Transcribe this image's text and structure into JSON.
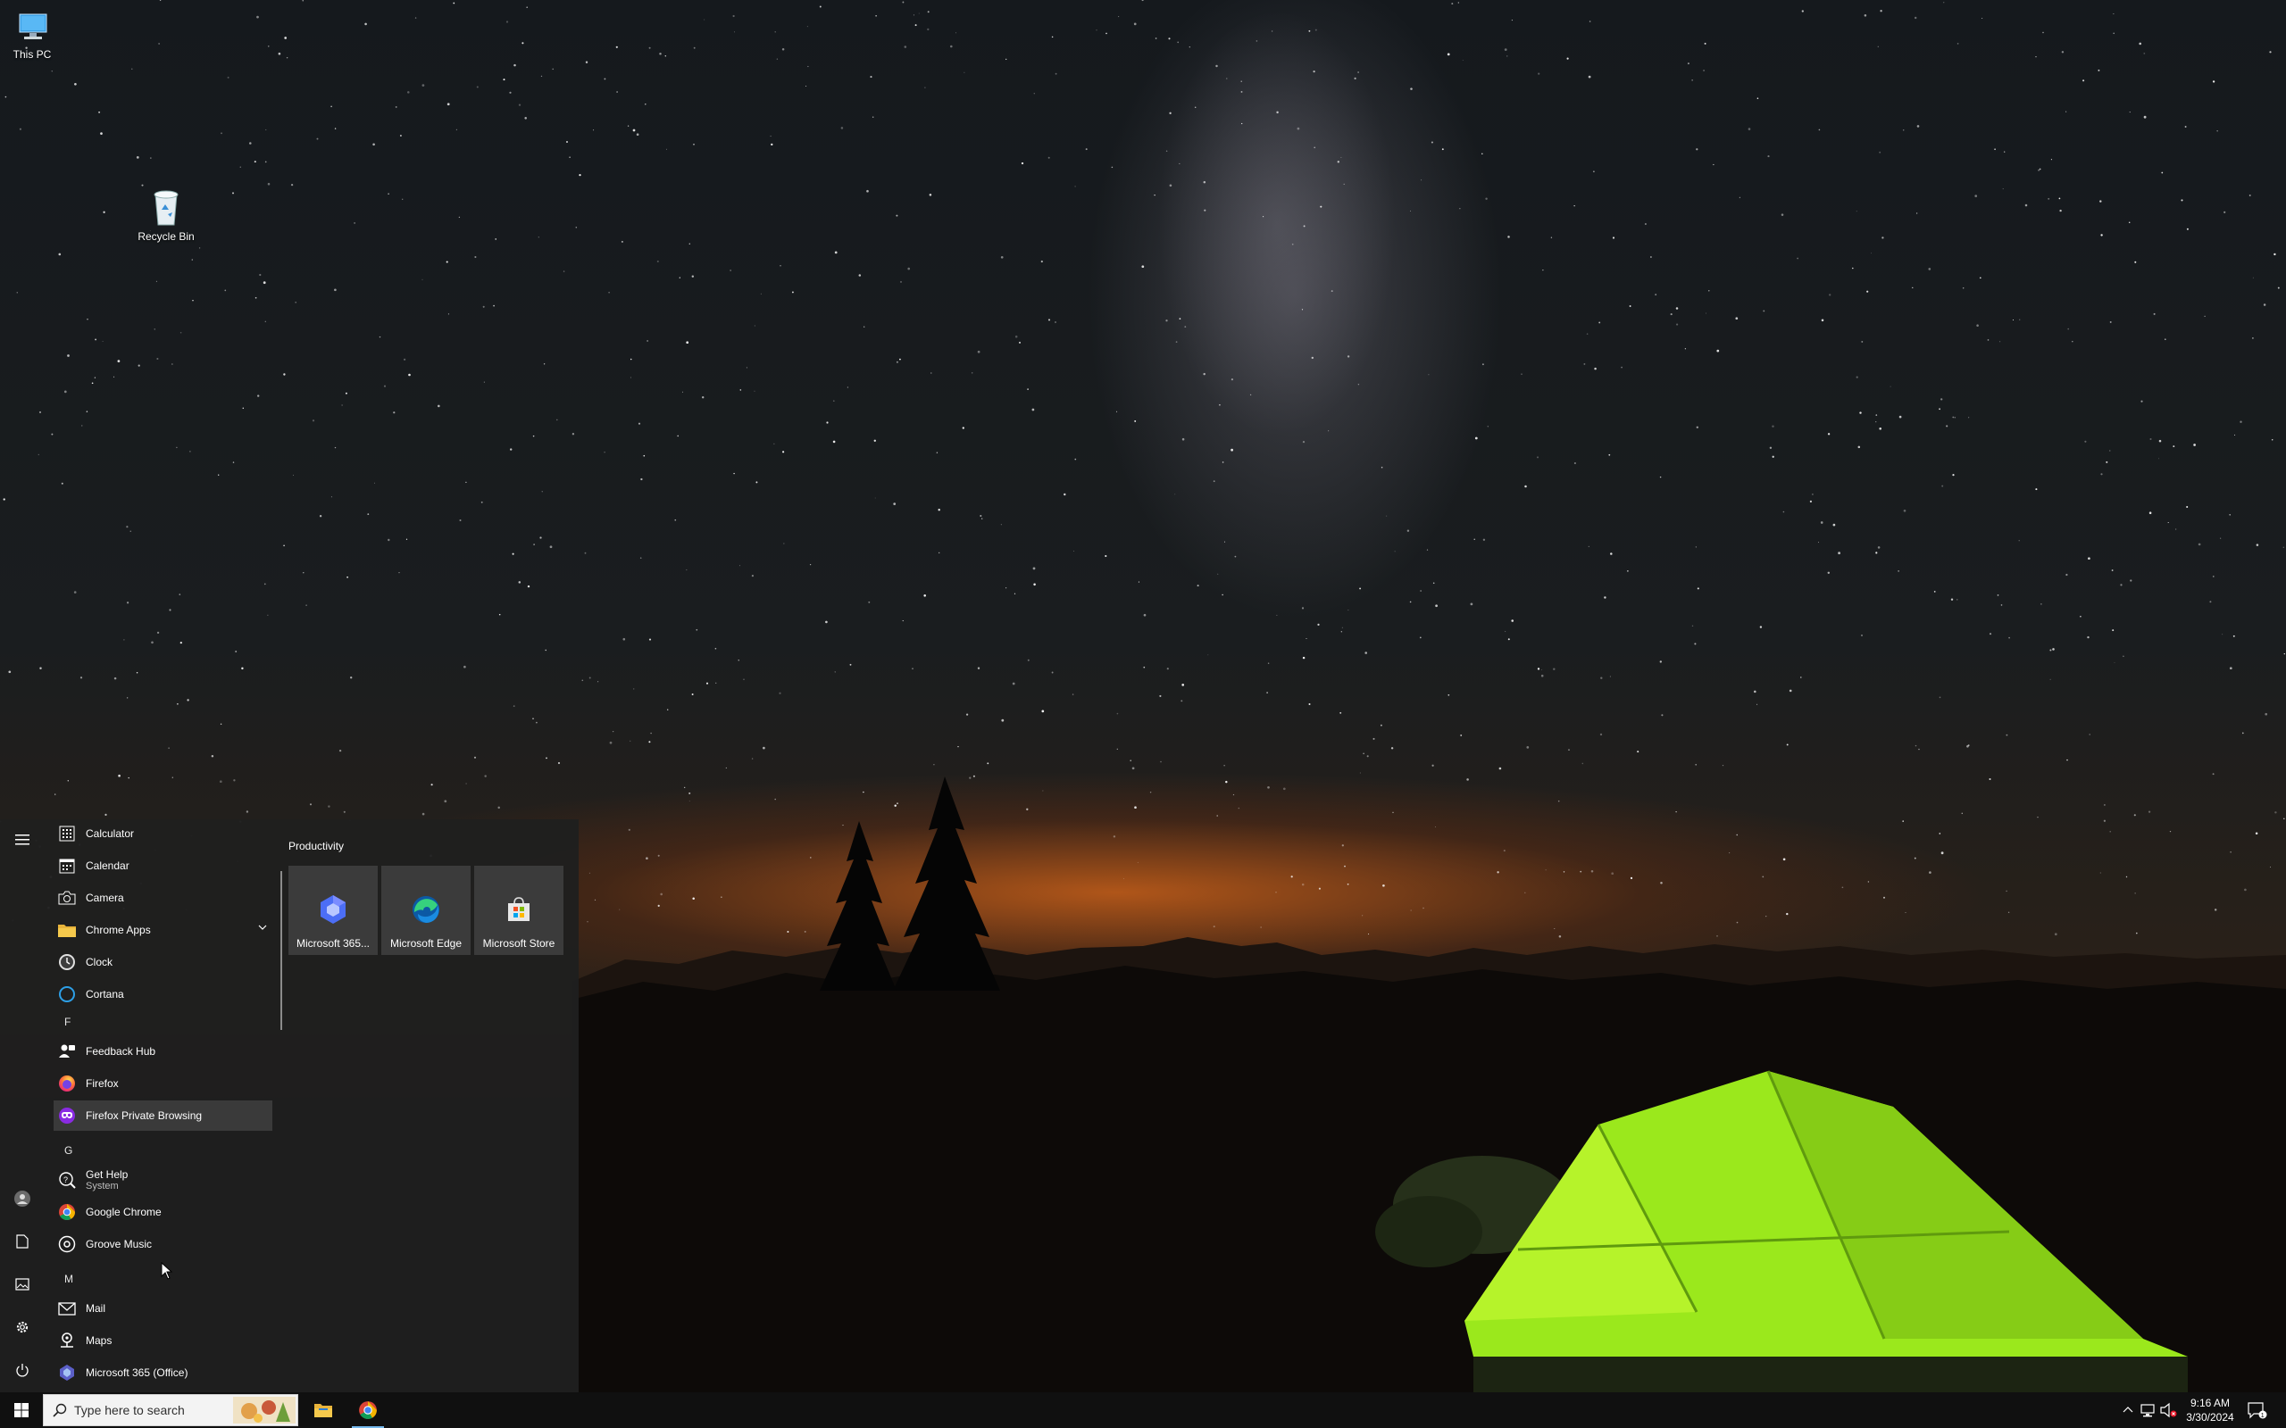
{
  "desktop": {
    "icons": [
      {
        "label": "This PC"
      },
      {
        "label": "Recycle Bin"
      }
    ]
  },
  "start_menu": {
    "apps": [
      {
        "label": "Calculator"
      },
      {
        "label": "Calendar"
      },
      {
        "label": "Camera"
      },
      {
        "label": "Chrome Apps"
      },
      {
        "label": "Clock"
      },
      {
        "label": "Cortana"
      },
      {
        "label": "Feedback Hub"
      },
      {
        "label": "Firefox"
      },
      {
        "label": "Firefox Private Browsing"
      },
      {
        "label": "Get Help",
        "sublabel": "System"
      },
      {
        "label": "Google Chrome"
      },
      {
        "label": "Groove Music"
      },
      {
        "label": "Mail"
      },
      {
        "label": "Maps"
      },
      {
        "label": "Microsoft 365 (Office)"
      }
    ],
    "letters": [
      "F",
      "G",
      "M"
    ],
    "group_title": "Productivity",
    "tiles": [
      {
        "label": "Microsoft 365..."
      },
      {
        "label": "Microsoft Edge"
      },
      {
        "label": "Microsoft Store"
      }
    ]
  },
  "taskbar": {
    "search_placeholder": "Type here to search",
    "time": "9:16 AM",
    "date": "3/30/2024"
  },
  "colors": {
    "start_bg": "#1f1f1f",
    "tile_bg": "#3b3b3b",
    "hover_bg": "#3a3a3a",
    "taskbar_bg": "#101010",
    "tent_green": "#9be81c"
  }
}
